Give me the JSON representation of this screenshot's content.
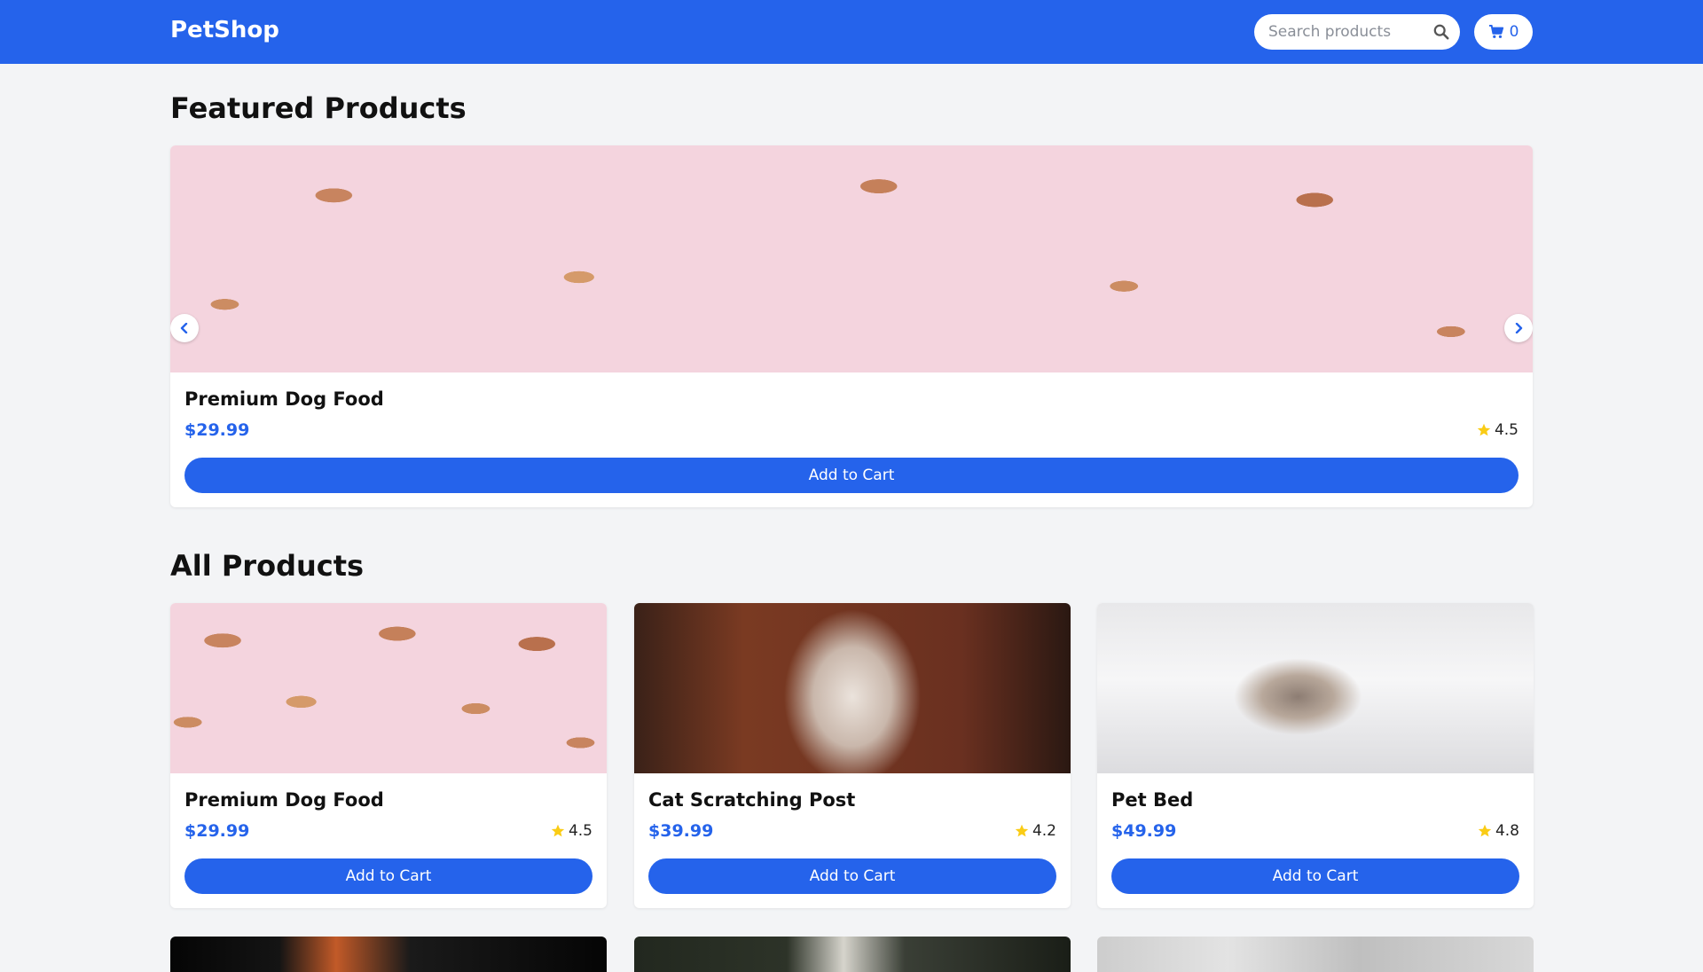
{
  "header": {
    "logo": "PetShop",
    "search": {
      "placeholder": "Search products",
      "value": ""
    },
    "cart_count": "0"
  },
  "featured": {
    "title": "Featured Products",
    "product": {
      "name": "Premium Dog Food",
      "price": "$29.99",
      "rating": "4.5",
      "button": "Add to Cart",
      "image": "dog-bone-treats"
    }
  },
  "all_products": {
    "title": "All Products",
    "items": [
      {
        "name": "Premium Dog Food",
        "price": "$29.99",
        "rating": "4.5",
        "button": "Add to Cart",
        "image": "dog-bone-treats"
      },
      {
        "name": "Cat Scratching Post",
        "price": "$39.99",
        "rating": "4.2",
        "button": "Add to Cart",
        "image": "white-cat"
      },
      {
        "name": "Pet Bed",
        "price": "$49.99",
        "rating": "4.8",
        "button": "Add to Cart",
        "image": "cat-under-blanket"
      }
    ]
  },
  "colors": {
    "brand": "#2563eb",
    "star": "#facc15",
    "background": "#f3f4f6"
  }
}
